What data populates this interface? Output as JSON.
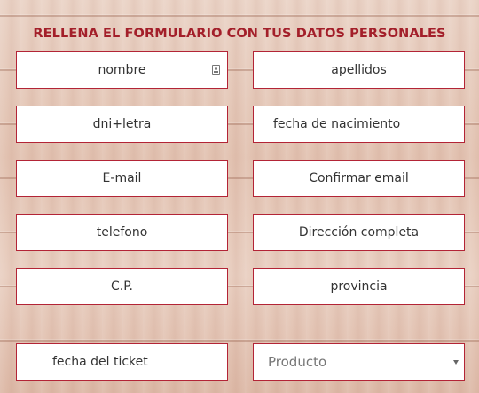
{
  "form": {
    "title": "RELLENA EL FORMULARIO CON TUS DATOS PERSONALES",
    "fields": {
      "nombre": "nombre",
      "apellidos": "apellidos",
      "dni": "dni+letra",
      "fecha_nacimiento": "fecha de nacimiento",
      "email": "E-mail",
      "confirmar_email": "Confirmar email",
      "telefono": "telefono",
      "direccion": "Dirección completa",
      "cp": "C.P.",
      "provincia": "provincia",
      "fecha_ticket": "fecha del ticket"
    },
    "producto_select": {
      "selected": "Producto"
    }
  },
  "icons": {
    "nombre_field_icon": "contact-card-icon",
    "select_arrow": "chevron-down-icon"
  },
  "colors": {
    "accent": "#a31f2a",
    "field_border": "#b32436"
  }
}
